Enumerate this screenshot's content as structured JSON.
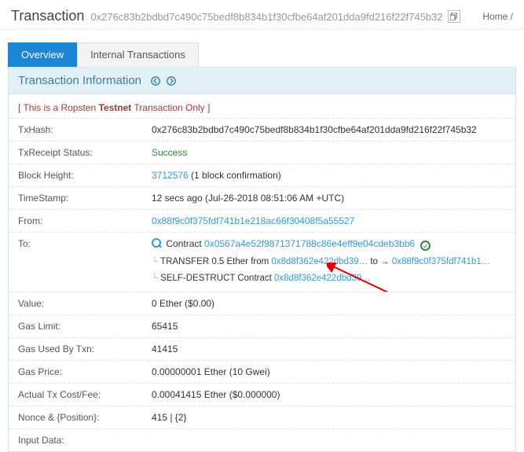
{
  "header": {
    "title": "Transaction",
    "txHash": "0x276c83b2bdbd7c490c75bedf8b834b1f30cfbe64af201dda9fd216f22f745b32",
    "breadcrumb": "Home  /"
  },
  "tabs": {
    "active": "Overview",
    "inactive": "Internal Transactions"
  },
  "panelTitle": "Transaction Information",
  "notice": {
    "prefix": "[ This is a Ropsten ",
    "bold": "Testnet",
    "suffix": " Transaction Only ]"
  },
  "rows": {
    "txhash": {
      "label": "TxHash:",
      "value": "0x276c83b2bdbd7c490c75bedf8b834b1f30cfbe64af201dda9fd216f22f745b32"
    },
    "status": {
      "label": "TxReceipt Status:",
      "value": "Success"
    },
    "block": {
      "label": "Block Height:",
      "link": "3712576",
      "suffix": " (1 block confirmation)"
    },
    "timestamp": {
      "label": "TimeStamp:",
      "value": "12 secs ago (Jul-26-2018 08:51:06 AM +UTC)"
    },
    "from": {
      "label": "From:",
      "value": "0x88f9c0f375fdf741b1e218ac66f30408f5a55527"
    },
    "to": {
      "label": "To:",
      "contractWord": "Contract ",
      "contractAddr": "0x0567a4e52f9871371788c86e4eff9e04cdeb3bb6",
      "line1a": "TRANSFER  0.5 Ether from ",
      "line1b": "0x8d8f362e422dbd39…",
      "line1c": " to → ",
      "line1d": "0x88f9c0f375fdf741b1…",
      "line2a": "SELF-DESTRUCT Contract ",
      "line2b": "0x8d8f362e422dbd39…"
    },
    "value": {
      "label": "Value:",
      "value": "0 Ether ($0.00)"
    },
    "gaslimit": {
      "label": "Gas Limit:",
      "value": "65415"
    },
    "gasused": {
      "label": "Gas Used By Txn:",
      "value": "41415"
    },
    "gasprice": {
      "label": "Gas Price:",
      "value": "0.00000001 Ether (10 Gwei)"
    },
    "cost": {
      "label": "Actual Tx Cost/Fee:",
      "value": "0.00041415 Ether ($0.000000)"
    },
    "nonce": {
      "label": "Nonce & {Position}:",
      "value": "415 | {2}"
    },
    "input": {
      "label": "Input Data:",
      "value": ""
    }
  }
}
